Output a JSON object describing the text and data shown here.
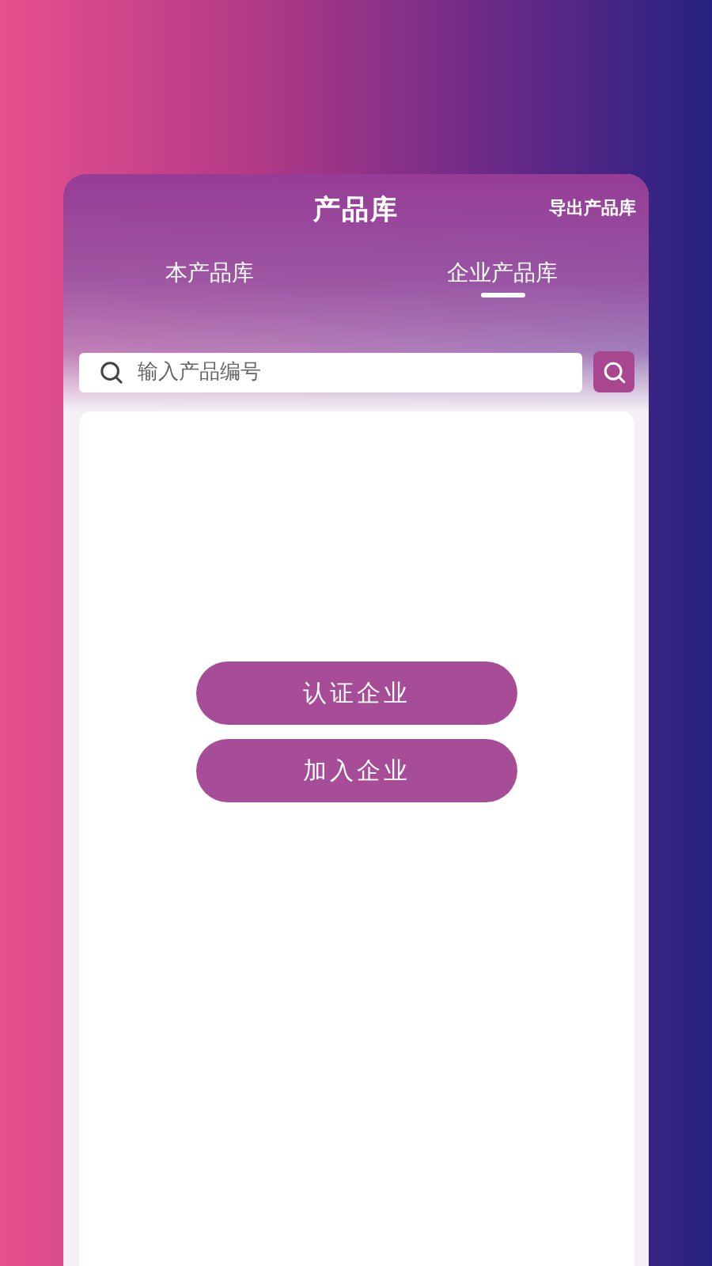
{
  "header": {
    "title": "产品库",
    "action": "导出产品库"
  },
  "tabs": [
    {
      "label": "本产品库",
      "selected": false
    },
    {
      "label": "企业产品库",
      "selected": true
    }
  ],
  "search": {
    "placeholder": "输入产品编号"
  },
  "buttons": [
    "认证企业",
    "加入企业"
  ]
}
